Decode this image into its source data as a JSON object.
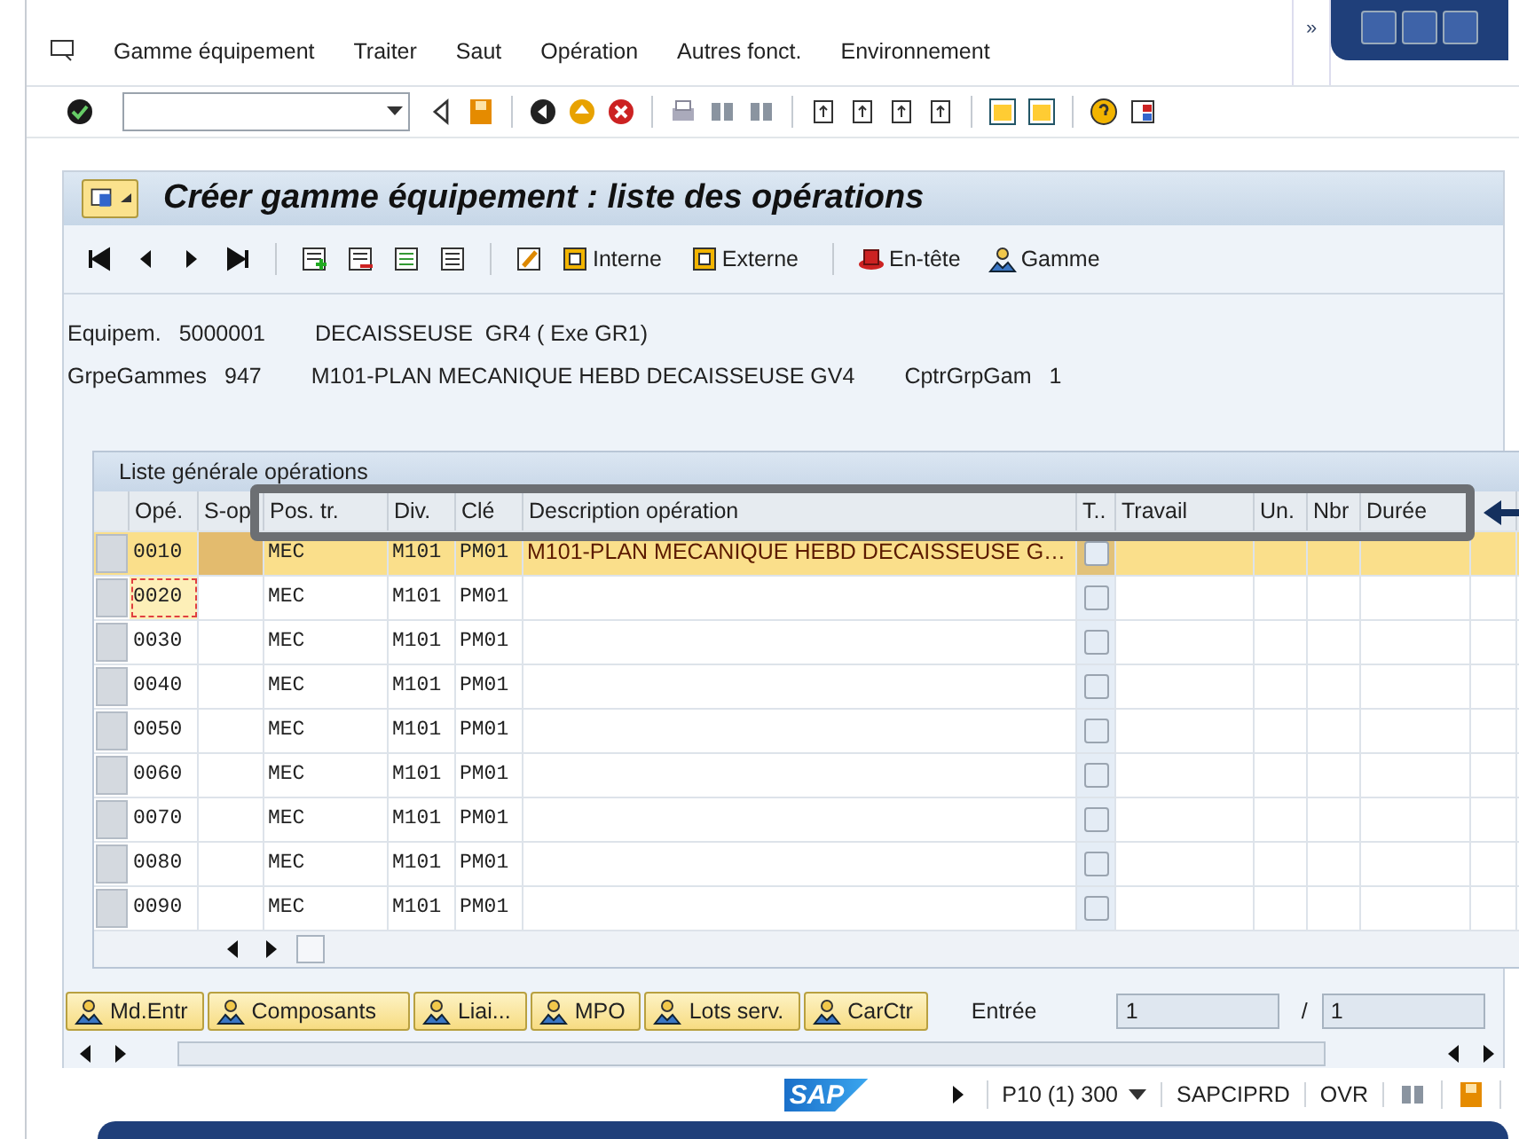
{
  "menu": {
    "items": [
      "Gamme équipement",
      "Traiter",
      "Saut",
      "Opération",
      "Autres fonct.",
      "Environnement"
    ],
    "overflow": "»"
  },
  "screen_title": "Créer gamme équipement : liste des opérations",
  "app_toolbar": [
    {
      "label": "Interne"
    },
    {
      "label": "Externe"
    },
    {
      "label": "En-tête"
    },
    {
      "label": "Gamme"
    }
  ],
  "header_info": [
    [
      {
        "kind": "label",
        "text": "Equipem."
      },
      {
        "kind": "value",
        "text": "5000001"
      },
      {
        "kind": "value",
        "text": "DECAISSEUSE  GR4 ( Exe GR1)"
      }
    ],
    [
      {
        "kind": "label",
        "text": "GrpeGammes"
      },
      {
        "kind": "value",
        "text": "947"
      },
      {
        "kind": "value",
        "text": "M101-PLAN MECANIQUE HEBD DECAISSEUSE GV4"
      },
      {
        "kind": "label",
        "text": "CptrGrpGam"
      },
      {
        "kind": "value",
        "text": "1"
      }
    ]
  ],
  "table": {
    "title": "Liste générale opérations",
    "columns": [
      "Opé.",
      "S-op",
      "Pos. tr.",
      "Div.",
      "Clé",
      "Description opération",
      "T..",
      "Travail",
      "Un.",
      "Nbr",
      "Durée"
    ],
    "rows": [
      {
        "ope": "0010",
        "pos": "MEC",
        "div": "M101",
        "key": "PM01",
        "desc": "M101-PLAN MECANIQUE HEBD DECAISSEUSE G…",
        "checked": false,
        "selected": true,
        "focused": false
      },
      {
        "ope": "0020",
        "pos": "MEC",
        "div": "M101",
        "key": "PM01",
        "checked": false,
        "selected": false,
        "focused": true
      },
      {
        "ope": "0030",
        "pos": "MEC",
        "div": "M101",
        "key": "PM01",
        "checked": false,
        "selected": false,
        "focused": false
      },
      {
        "ope": "0040",
        "pos": "MEC",
        "div": "M101",
        "key": "PM01",
        "checked": false,
        "selected": false,
        "focused": false
      },
      {
        "ope": "0050",
        "pos": "MEC",
        "div": "M101",
        "key": "PM01",
        "checked": false,
        "selected": false,
        "focused": false
      },
      {
        "ope": "0060",
        "pos": "MEC",
        "div": "M101",
        "key": "PM01",
        "checked": false,
        "selected": false,
        "focused": false
      },
      {
        "ope": "0070",
        "pos": "MEC",
        "div": "M101",
        "key": "PM01",
        "checked": false,
        "selected": false,
        "focused": false
      },
      {
        "ope": "0080",
        "pos": "MEC",
        "div": "M101",
        "key": "PM01",
        "checked": false,
        "selected": false,
        "focused": false
      },
      {
        "ope": "0090",
        "pos": "MEC",
        "div": "M101",
        "key": "PM01",
        "checked": false,
        "selected": false,
        "focused": false
      }
    ]
  },
  "bottom_buttons": [
    "Md.Entr",
    "Composants",
    "Liai...",
    "MPO",
    "Lots serv.",
    "CarCtr"
  ],
  "entry": {
    "label": "Entrée",
    "value": "1",
    "separator": "/",
    "total": "1"
  },
  "status_bar": {
    "logo": "SAP",
    "system": "P10 (1) 300",
    "server": "SAPCIPRD",
    "mode": "OVR"
  }
}
